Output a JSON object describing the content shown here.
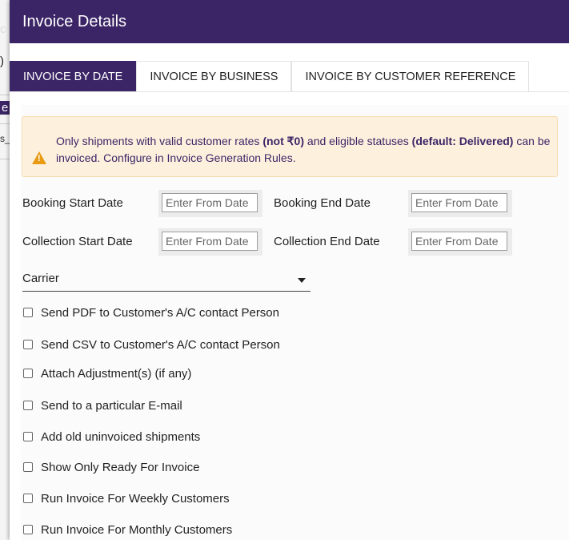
{
  "background": {
    "fragments": [
      "c",
      ")",
      "e",
      "s_"
    ]
  },
  "modal": {
    "title": "Invoice Details",
    "tabs": [
      {
        "label": "INVOICE BY DATE",
        "active": true
      },
      {
        "label": "INVOICE BY BUSINESS",
        "active": false
      },
      {
        "label": "INVOICE BY CUSTOMER REFERENCE",
        "active": false
      }
    ],
    "notice": {
      "part1": "Only shipments with valid customer rates ",
      "bold1": "(not ₹0)",
      "part2": " and eligible statuses ",
      "bold2": "(default: Delivered)",
      "part3": " can be invoiced. Configure in Invoice Generation Rules."
    },
    "dates": {
      "booking_start_label": "Booking Start Date",
      "booking_end_label": "Booking End Date",
      "collection_start_label": "Collection Start Date",
      "collection_end_label": "Collection End Date",
      "placeholder": "Enter From Date"
    },
    "carrier": {
      "label": "Carrier"
    },
    "options": [
      "Send PDF to Customer's A/C contact Person",
      "Send CSV to Customer's A/C contact Person",
      "Attach Adjustment(s) (if any)",
      "Send to a particular E-mail",
      "Add old uninvoiced shipments",
      "Show Only Ready For Invoice",
      "Run Invoice For Weekly Customers",
      "Run Invoice For Monthly Customers"
    ],
    "colors": {
      "header": "#3b2566",
      "notice_bg": "#fdf1de",
      "warning": "#e89b13"
    }
  }
}
